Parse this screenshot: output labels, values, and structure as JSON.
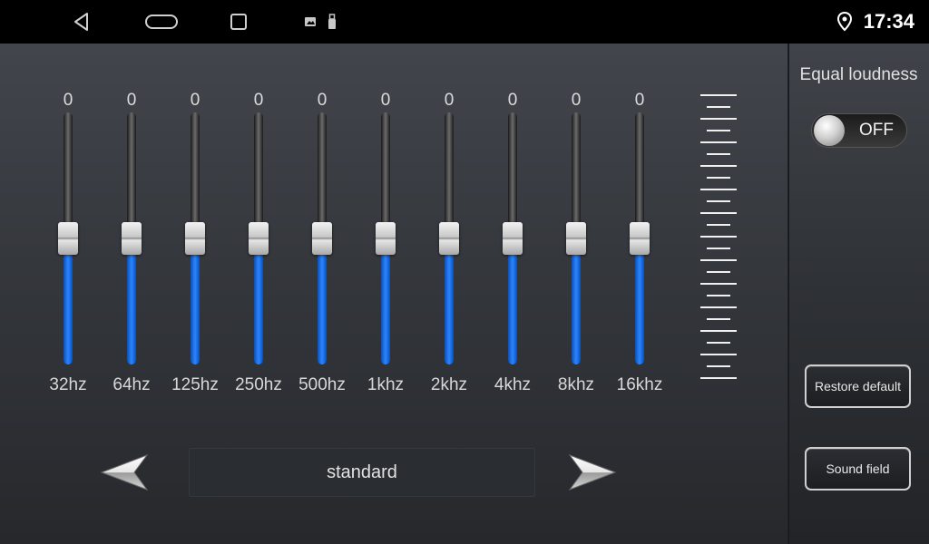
{
  "status_bar": {
    "time": "17:34",
    "icons": [
      "back-icon",
      "home-icon",
      "recents-icon",
      "image-icon",
      "usb-icon",
      "location-icon"
    ]
  },
  "equalizer": {
    "bands": [
      {
        "label": "32hz",
        "value": "0",
        "level": 0.5
      },
      {
        "label": "64hz",
        "value": "0",
        "level": 0.5
      },
      {
        "label": "125hz",
        "value": "0",
        "level": 0.5
      },
      {
        "label": "250hz",
        "value": "0",
        "level": 0.5
      },
      {
        "label": "500hz",
        "value": "0",
        "level": 0.5
      },
      {
        "label": "1khz",
        "value": "0",
        "level": 0.5
      },
      {
        "label": "2khz",
        "value": "0",
        "level": 0.5
      },
      {
        "label": "4khz",
        "value": "0",
        "level": 0.5
      },
      {
        "label": "8khz",
        "value": "0",
        "level": 0.5
      },
      {
        "label": "16khz",
        "value": "0",
        "level": 0.5
      }
    ],
    "preset": "standard"
  },
  "side_panel": {
    "loudness_title": "Equal loudness",
    "loudness_toggle": "OFF",
    "restore_label": "Restore default",
    "sound_field_label": "Sound field"
  },
  "colors": {
    "fill_blue": "#1f78f0",
    "background": "#34373c",
    "status_bar": "#000000"
  }
}
